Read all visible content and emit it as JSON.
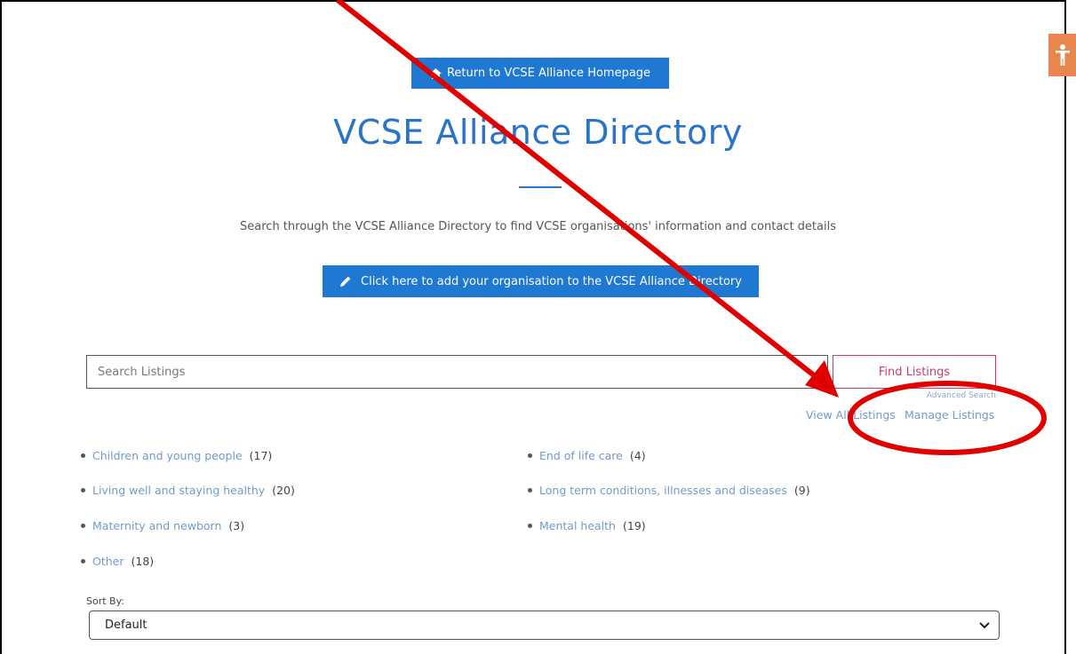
{
  "header": {
    "return_label": "Return to VCSE Alliance Homepage",
    "title": "VCSE Alliance Directory",
    "intro": "Search through the VCSE Alliance Directory to find VCSE organisations' information and contact details",
    "add_label": "Click here to add your organisation to the VCSE Alliance Directory"
  },
  "search": {
    "placeholder": "Search Listings",
    "find_label": "Find Listings",
    "advanced_label": "Advanced Search",
    "view_all_label": "View All Listings",
    "manage_label": "Manage Listings"
  },
  "categories": [
    {
      "label": "Children and young people",
      "count": "(17)"
    },
    {
      "label": "End of life care",
      "count": "(4)"
    },
    {
      "label": "Living well and staying healthy",
      "count": "(20)"
    },
    {
      "label": "Long term conditions, illnesses and diseases",
      "count": "(9)"
    },
    {
      "label": "Maternity and newborn",
      "count": "(3)"
    },
    {
      "label": "Mental health",
      "count": "(19)"
    },
    {
      "label": "Other",
      "count": "(18)"
    }
  ],
  "sort": {
    "label": "Sort By:",
    "selected": "Default"
  },
  "colors": {
    "primary": "#1f78d1",
    "title": "#2a74c8",
    "accent": "#c93c6f",
    "link": "#6f9cc9",
    "annotation": "#e00000",
    "accessibility": "#e8864e"
  },
  "icons": {
    "home": "home-icon",
    "pencil": "pencil-icon",
    "accessibility": "accessibility-icon",
    "chevron": "chevron-down-icon"
  }
}
